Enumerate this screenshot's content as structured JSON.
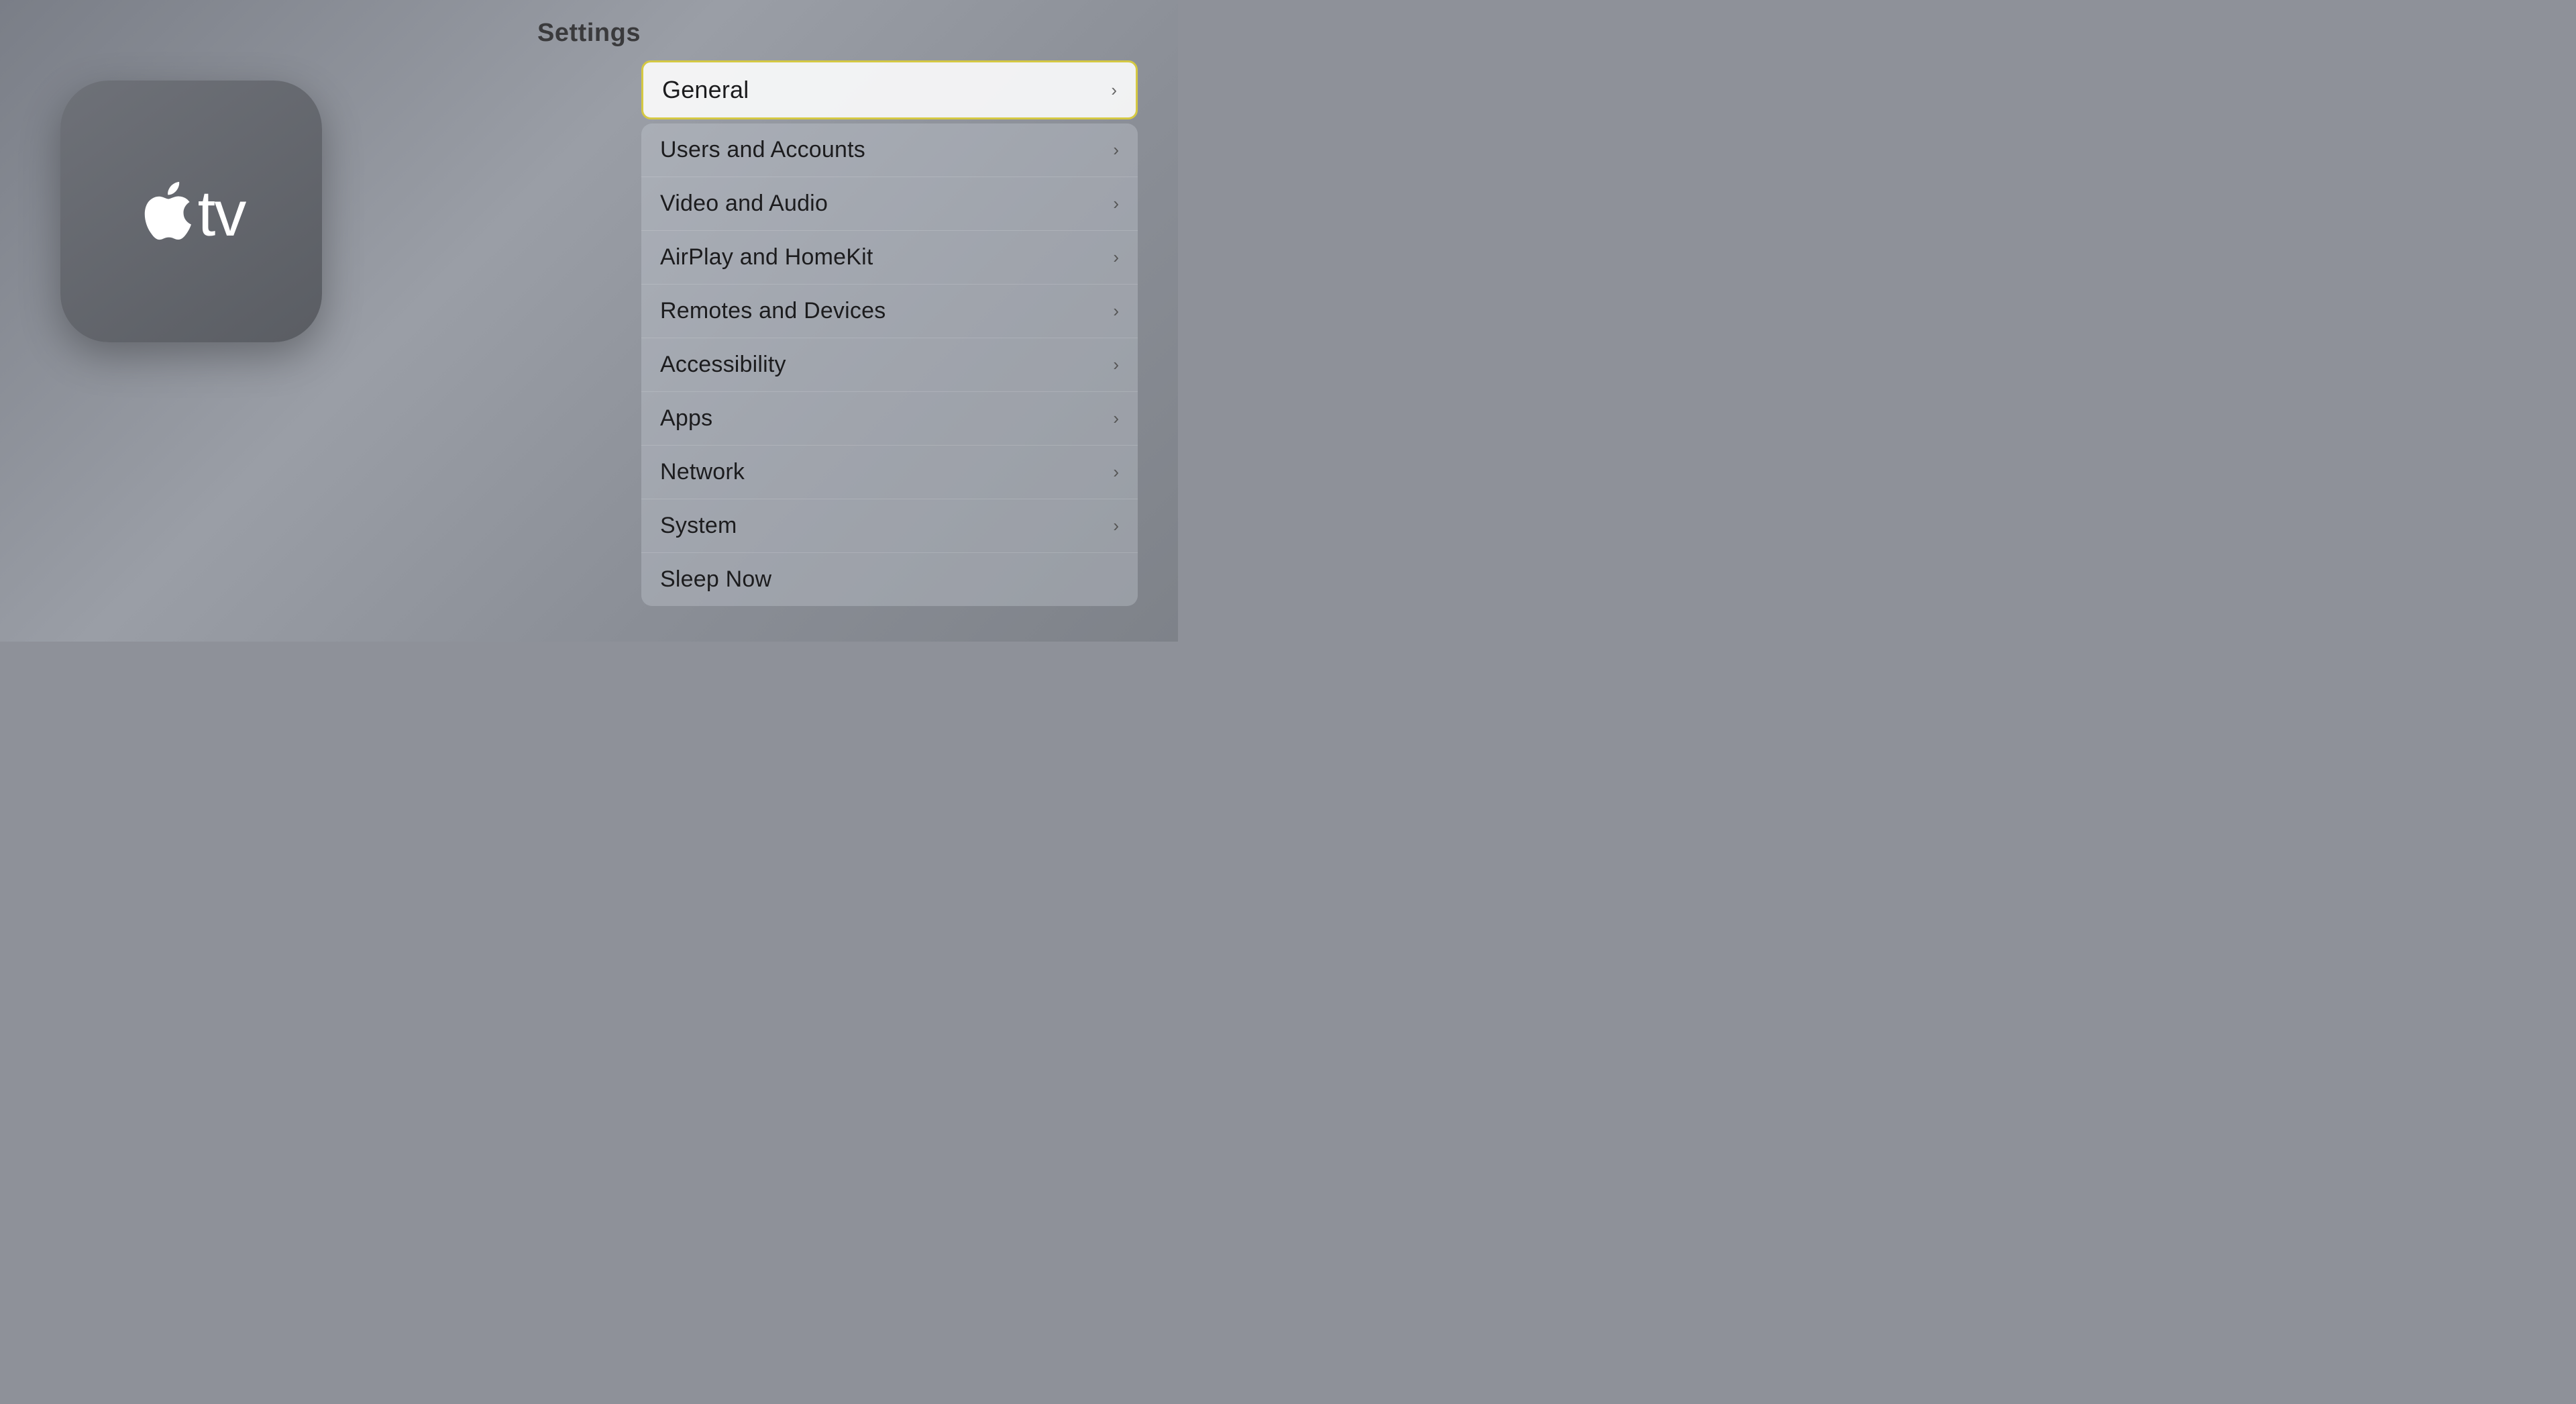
{
  "page": {
    "title": "Settings"
  },
  "logo": {
    "tv_text": "tv"
  },
  "menu": {
    "selected_item": {
      "label": "General",
      "has_chevron": true
    },
    "items": [
      {
        "label": "Users and Accounts",
        "has_chevron": true
      },
      {
        "label": "Video and Audio",
        "has_chevron": true
      },
      {
        "label": "AirPlay and HomeKit",
        "has_chevron": true
      },
      {
        "label": "Remotes and Devices",
        "has_chevron": true
      },
      {
        "label": "Accessibility",
        "has_chevron": true
      },
      {
        "label": "Apps",
        "has_chevron": true
      },
      {
        "label": "Network",
        "has_chevron": true
      },
      {
        "label": "System",
        "has_chevron": true
      },
      {
        "label": "Sleep Now",
        "has_chevron": false
      }
    ]
  },
  "colors": {
    "selected_border": "#d4c843",
    "background": "#8e9199",
    "selected_bg": "rgba(255,255,255,0.92)"
  },
  "icons": {
    "chevron": "›",
    "apple_logo": ""
  }
}
